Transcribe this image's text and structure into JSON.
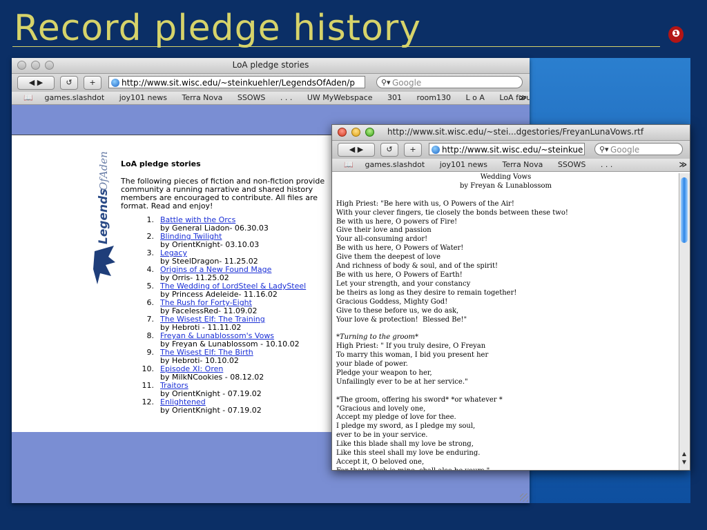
{
  "slide": {
    "title": "Record pledge history",
    "nav_icon": "back-arrow-icon",
    "nav_glyph": "❶"
  },
  "browser1": {
    "window_title": "LoA pledge stories",
    "back_forward": "◀ ▶",
    "reload": "↺",
    "add": "+",
    "url": "http://www.sit.wisc.edu/~steinkuehler/LegendsOfAden/p",
    "search_placeholder": "Google",
    "bookmarks": [
      "games.slashdot",
      "joy101 news",
      "Terra Nova",
      "SSOWS",
      ". . .",
      "UW MyWebspace",
      "301",
      "room130",
      "L o A",
      "LoA forum"
    ],
    "bookmarks_more": "≫",
    "page": {
      "logo_text": "LegendsOfAden",
      "heading": "LoA pledge stories",
      "intro": "The following pieces of fiction and non-fiction provide\ncommunity a running narrative and shared history\nmembers are encouraged to contribute. All files are\nformat. Read and enjoy!",
      "stories": [
        {
          "num": "1.",
          "title": "Battle with the Orcs",
          "byline": "by General Liadon- 06.30.03"
        },
        {
          "num": "2.",
          "title": "Blinding Twilight",
          "byline": "by OrientKnight- 03.10.03"
        },
        {
          "num": "3.",
          "title": "Legacy",
          "byline": "by SteelDragon- 11.25.02"
        },
        {
          "num": "4.",
          "title": "Origins of a New Found Mage",
          "byline": "by Orris- 11.25.02"
        },
        {
          "num": "5.",
          "title": "The Wedding of LordSteel & LadySteel",
          "byline": "by Princess Adeleide- 11.16.02"
        },
        {
          "num": "6.",
          "title": "The Rush for Forty-Eight",
          "byline": "by FacelessRed- 11.09.02"
        },
        {
          "num": "7.",
          "title": "The Wisest Elf: The Training",
          "byline": "by Hebroti - 11.11.02"
        },
        {
          "num": "8.",
          "title": "Freyan & Lunablossom's Vows",
          "byline": "by Freyan & Lunablossom - 10.10.02"
        },
        {
          "num": "9.",
          "title": "The Wisest Elf: The Birth",
          "byline": "by Hebroti- 10.10.02"
        },
        {
          "num": "10.",
          "title": "Episode XI: Oren",
          "byline": "by MilkNCookies - 08.12.02"
        },
        {
          "num": "11.",
          "title": "Traitors",
          "byline": "by OrientKnight - 07.19.02"
        },
        {
          "num": "12.",
          "title": "Enlightened",
          "byline": "by OrientKnight - 07.19.02"
        }
      ]
    }
  },
  "browser2": {
    "window_title": "http://www.sit.wisc.edu/~stei...dgestories/FreyanLunaVows.rtf",
    "back_forward": "◀ ▶",
    "reload": "↺",
    "add": "+",
    "url": "http://www.sit.wisc.edu/~steinkue",
    "search_placeholder": "Google",
    "bookmarks": [
      "games.slashdot",
      "joy101 news",
      "Terra Nova",
      "SSOWS",
      ". . ."
    ],
    "bookmarks_more": "≫",
    "doc": {
      "title": "Wedding Vows",
      "byline": "by Freyan & Lunablossom",
      "lines": [
        "",
        "High Priest: \"Be here with us, O Powers of the Air!",
        "With your clever fingers, tie closely the bonds between these two!",
        "Be with us here, O powers of Fire!",
        "Give their love and passion",
        "Your all-consuming ardor!",
        "Be with us here, O Powers of Water!",
        "Give them the deepest of love",
        "And richness of body & soul, and of the spirit!",
        "Be with us here, O Powers of Earth!",
        "Let your strength, and your constancy",
        "be theirs as long as they desire to remain together!",
        "Gracious Goddess, Mighty God!",
        "Give to these before us, we do ask,",
        "Your love & protection!  Blessed Be!\"",
        "",
        "*Turning to the groom*",
        "High Priest: \" If you truly desire, O Freyan",
        "To marry this woman, I bid you present her",
        "your blade of power.",
        "Pledge your weapon to her,",
        "Unfailingly ever to be at her service.\"",
        "",
        "*The groom, offering his sword* *or whatever *",
        "\"Gracious and lovely one,",
        "Accept my pledge of love for thee.",
        "I pledge my sword, as I pledge my soul,",
        "ever to be in your service.",
        "Like this blade shall my love be strong,",
        "Like this steel shall my love be enduring.",
        "Accept it, O beloved one,",
        "For that which is mine, shall also be yours.\""
      ]
    }
  }
}
